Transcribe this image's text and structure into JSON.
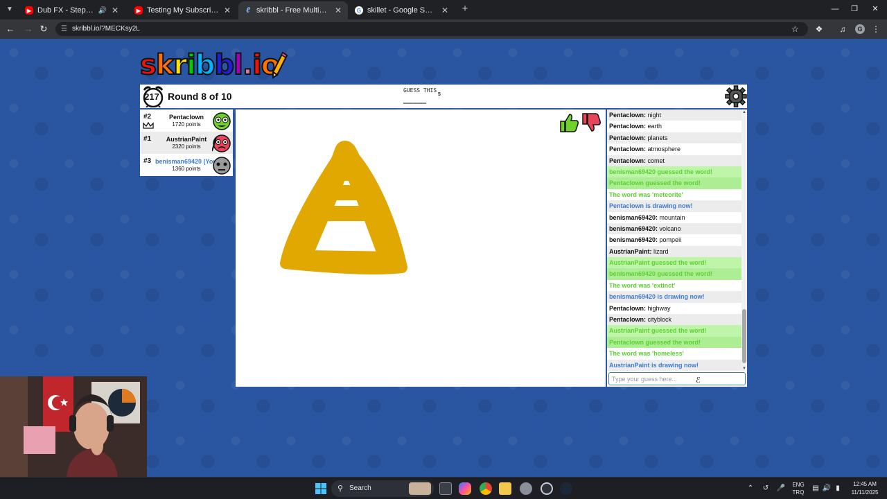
{
  "browser": {
    "tabs": [
      {
        "title": "Dub FX - Step on my trip - ",
        "favicon": "youtube-icon"
      },
      {
        "title": "Testing My Subscribers' Struggl",
        "favicon": "youtube-icon"
      },
      {
        "title": "skribbl - Free Multiplayer Draw",
        "favicon": "skribbl-icon"
      },
      {
        "title": "skillet - Google Search",
        "favicon": "google-icon"
      }
    ],
    "url": "skribbl.io/?MECKsy2L",
    "profile_initial": "G"
  },
  "game": {
    "logo_letters": [
      "s",
      "k",
      "r",
      "i",
      "b",
      "b",
      "l",
      ".",
      "i",
      "o"
    ],
    "logo_colors": [
      "#ef130b",
      "#ff7100",
      "#ffe400",
      "#00cc00",
      "#00b2ff",
      "#231fd3",
      "#a300ba",
      "#d37caa",
      "#ef130b",
      "#ff7100"
    ],
    "timer": "217",
    "round_text": "Round 8 of 10",
    "guess_label": "GUESS THIS",
    "guess_count": "5",
    "guess_blanks": "_____",
    "players": [
      {
        "rank": "#2",
        "name": "Pentaclown",
        "points": "1720 points",
        "crown": true,
        "you": false,
        "avatar_color": "#6fd12a"
      },
      {
        "rank": "#1",
        "name": "AustrianPaint",
        "points": "2320 points",
        "crown": false,
        "you": false,
        "avatar_color": "#e8455b"
      },
      {
        "rank": "#3",
        "name": "benisman69420 (You)",
        "points": "1360 points",
        "crown": false,
        "you": true,
        "avatar_color": "#9a9a9a"
      }
    ],
    "drawing_color": "#e0a800",
    "chat": [
      {
        "type": "guess",
        "who": "Pentaclown:",
        "text": " night"
      },
      {
        "type": "guess",
        "who": "Pentaclown:",
        "text": " earth"
      },
      {
        "type": "guess",
        "who": "Pentaclown:",
        "text": " planets"
      },
      {
        "type": "guess",
        "who": "Pentaclown:",
        "text": " atmosphere"
      },
      {
        "type": "guess",
        "who": "Pentaclown:",
        "text": " comet"
      },
      {
        "type": "correct",
        "who": "",
        "text": "benisman69420 guessed the word!"
      },
      {
        "type": "correct",
        "who": "",
        "text": "Pentaclown guessed the word!"
      },
      {
        "type": "reveal",
        "who": "",
        "text": "The word was 'meteorite'"
      },
      {
        "type": "draw",
        "who": "",
        "text": "Pentaclown is drawing now!"
      },
      {
        "type": "guess",
        "who": "benisman69420:",
        "text": " mountain"
      },
      {
        "type": "guess",
        "who": "benisman69420:",
        "text": " volcano"
      },
      {
        "type": "guess",
        "who": "benisman69420:",
        "text": " pompeii"
      },
      {
        "type": "guess",
        "who": "AustrianPaint:",
        "text": " lizard"
      },
      {
        "type": "correct",
        "who": "",
        "text": "AustrianPaint guessed the word!"
      },
      {
        "type": "correct",
        "who": "",
        "text": "benisman69420 guessed the word!"
      },
      {
        "type": "reveal",
        "who": "",
        "text": "The word was 'extinct'"
      },
      {
        "type": "draw",
        "who": "",
        "text": "benisman69420 is drawing now!"
      },
      {
        "type": "guess",
        "who": "Pentaclown:",
        "text": " highway"
      },
      {
        "type": "guess",
        "who": "Pentaclown:",
        "text": " cityblock"
      },
      {
        "type": "correct",
        "who": "",
        "text": "AustrianPaint guessed the word!"
      },
      {
        "type": "correct",
        "who": "",
        "text": "Pentaclown guessed the word!"
      },
      {
        "type": "reveal",
        "who": "",
        "text": "The word was 'homeless'"
      },
      {
        "type": "draw",
        "who": "",
        "text": "AustrianPaint is drawing now!"
      }
    ],
    "chat_placeholder": "Type your guess here..."
  },
  "taskbar": {
    "search_label": "Search",
    "lang_top": "ENG",
    "lang_bottom": "TRQ",
    "time": "12:45 AM",
    "date": "11/11/2025"
  }
}
